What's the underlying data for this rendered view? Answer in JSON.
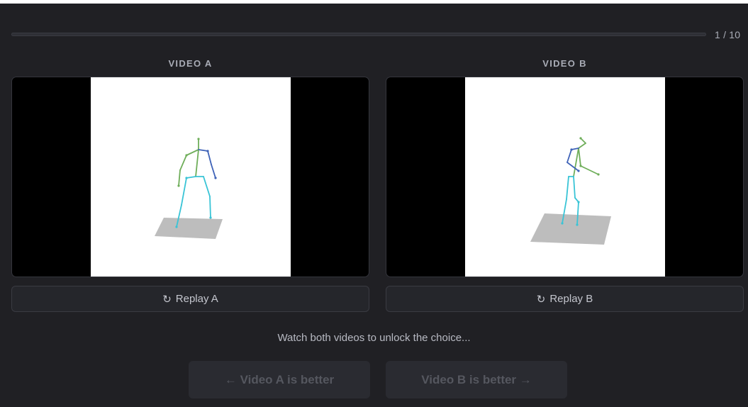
{
  "progress": {
    "current": 1,
    "total": 10,
    "label": "1 / 10",
    "fraction": 0.0
  },
  "videos": [
    {
      "heading": "VIDEO A",
      "replay_label": "Replay A",
      "replay_icon": "↻"
    },
    {
      "heading": "VIDEO B",
      "replay_label": "Replay B",
      "replay_icon": "↻"
    }
  ],
  "status": {
    "text": "Watch both videos to unlock the choice..."
  },
  "choices": {
    "a_label": "← Video A is better",
    "b_label": "Video B is better →"
  },
  "colors": {
    "background": "#202024",
    "panel_border": "#34353c",
    "floor": "#bdbdbd",
    "bone_cyan": "#39c4d6",
    "bone_green": "#6fae5a",
    "bone_blue": "#3f63b8"
  }
}
